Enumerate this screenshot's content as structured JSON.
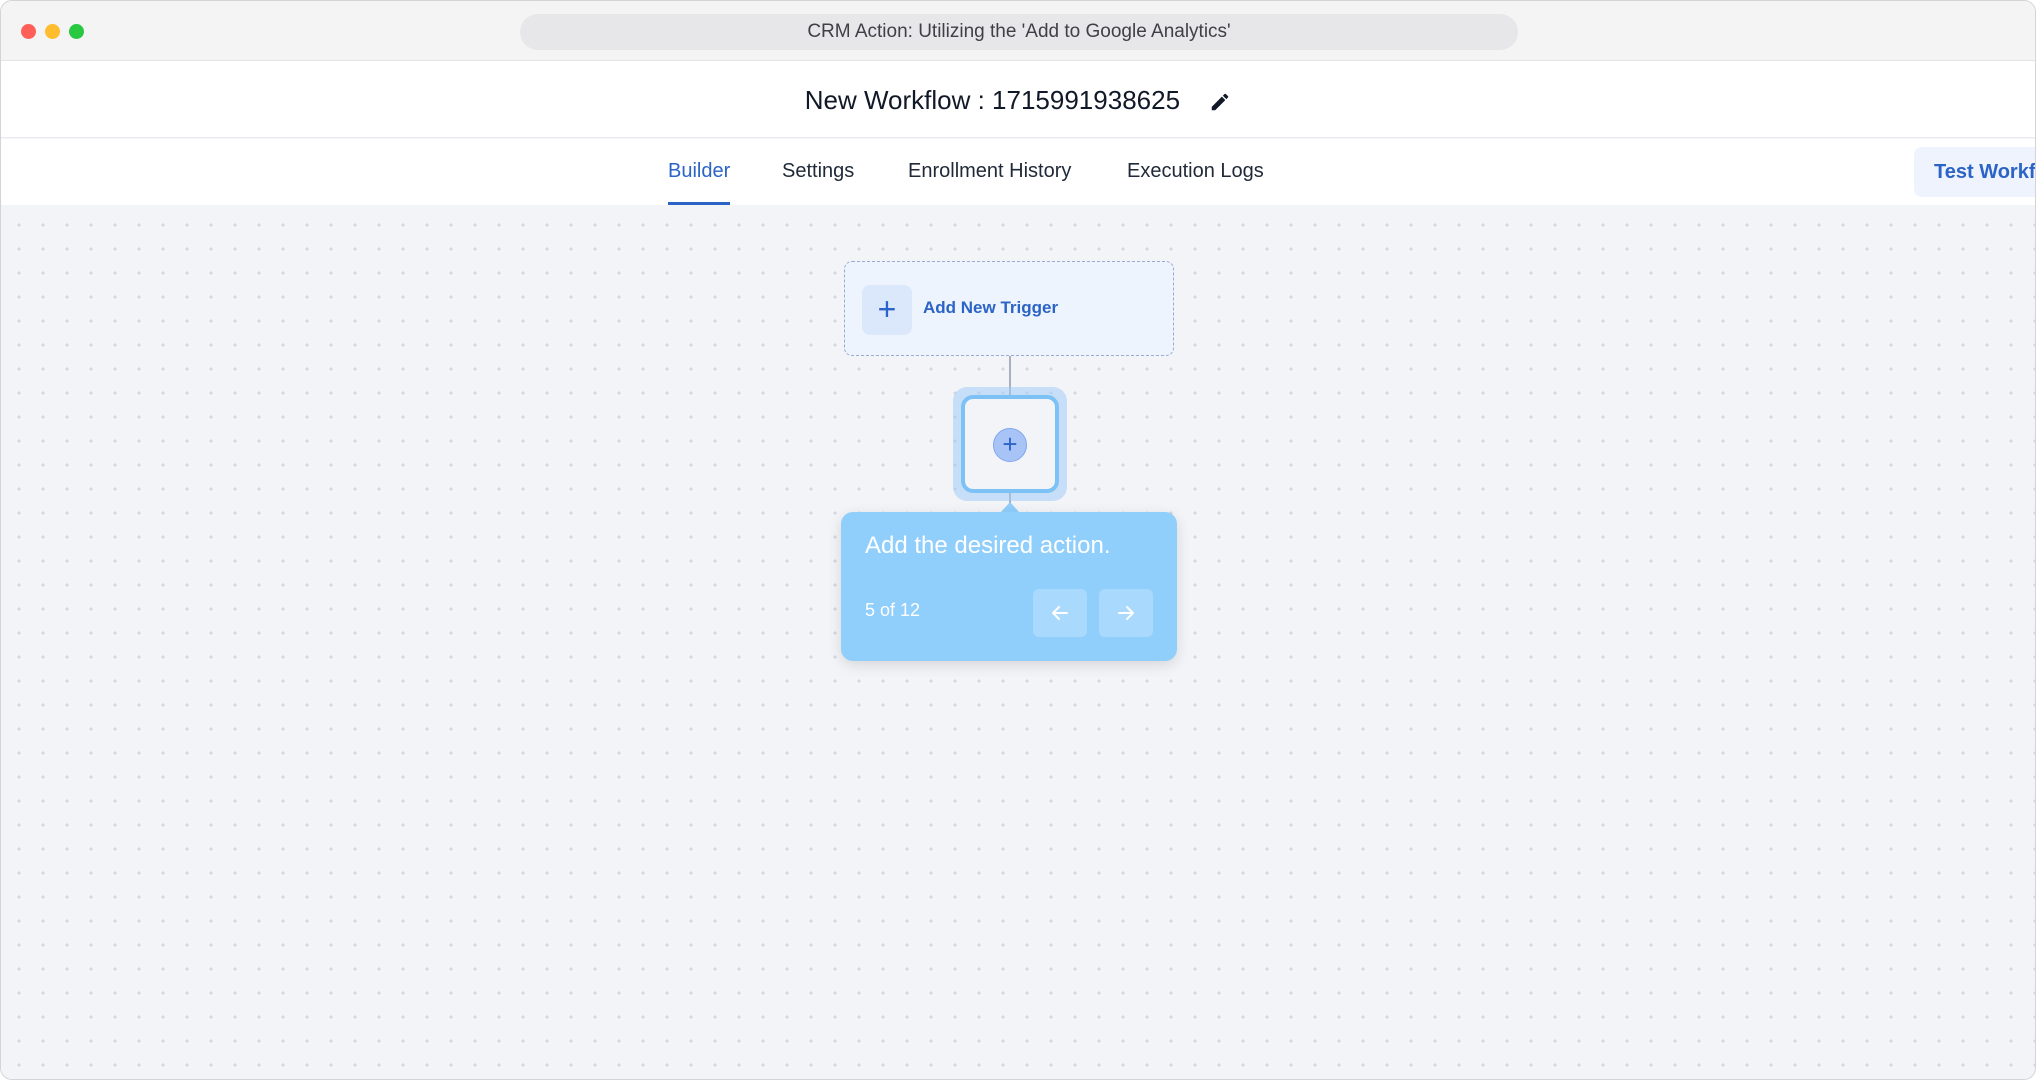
{
  "window": {
    "title": "CRM Action: Utilizing the 'Add to Google Analytics'"
  },
  "workflow": {
    "name": "New Workflow : 1715991938625"
  },
  "tabs": [
    {
      "label": "Builder",
      "active": true
    },
    {
      "label": "Settings",
      "active": false
    },
    {
      "label": "Enrollment History",
      "active": false
    },
    {
      "label": "Execution Logs",
      "active": false
    }
  ],
  "toolbar": {
    "test_label": "Test Workflow"
  },
  "canvas": {
    "trigger_label": "Add New Trigger",
    "plus_glyph": "+",
    "add_action_glyph": "+"
  },
  "tooltip": {
    "text": "Add the desired action.",
    "progress": "5 of 12"
  },
  "icons": {
    "edit": "pencil-icon",
    "prev": "arrow-left-icon",
    "next": "arrow-right-icon"
  },
  "colors": {
    "accent": "#2b63c6",
    "tooltip_bg": "#90cefb",
    "highlight": "#7cc2f6",
    "canvas_bg": "#f3f4f7"
  }
}
